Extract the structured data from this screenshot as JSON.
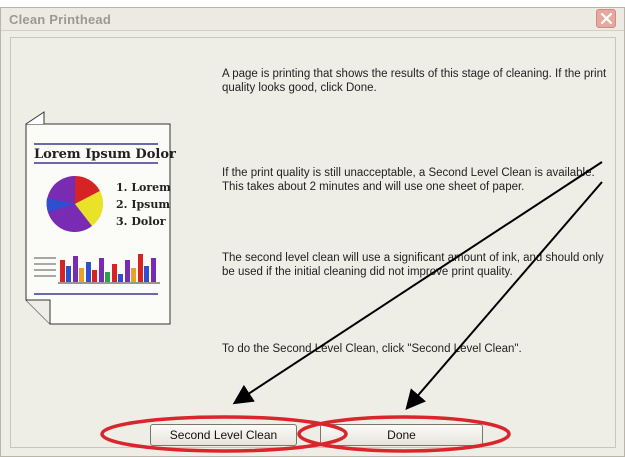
{
  "window": {
    "title": "Clean Printhead"
  },
  "messages": {
    "m1": "A page is printing that shows the results of this stage of cleaning. If the print quality looks good, click Done.",
    "m2": "If the print quality is still unacceptable, a Second Level Clean is available. This takes about 2 minutes and will use one sheet of paper.",
    "m3": "The second level clean will use a significant amount of ink, and should only be used if the initial cleaning did not improve print quality.",
    "m4": "To do the Second Level Clean, click \"Second Level Clean\"."
  },
  "illustration": {
    "heading": "Lorem Ipsum Dolor",
    "items": [
      "1. Lorem",
      "2. Ipsum",
      "3. Dolor"
    ]
  },
  "buttons": {
    "second_level_clean": "Second Level Clean",
    "done": "Done"
  },
  "icons": {
    "close": "close-x-icon"
  },
  "colors": {
    "highlight": "#d9252b",
    "arrow": "#000000"
  }
}
